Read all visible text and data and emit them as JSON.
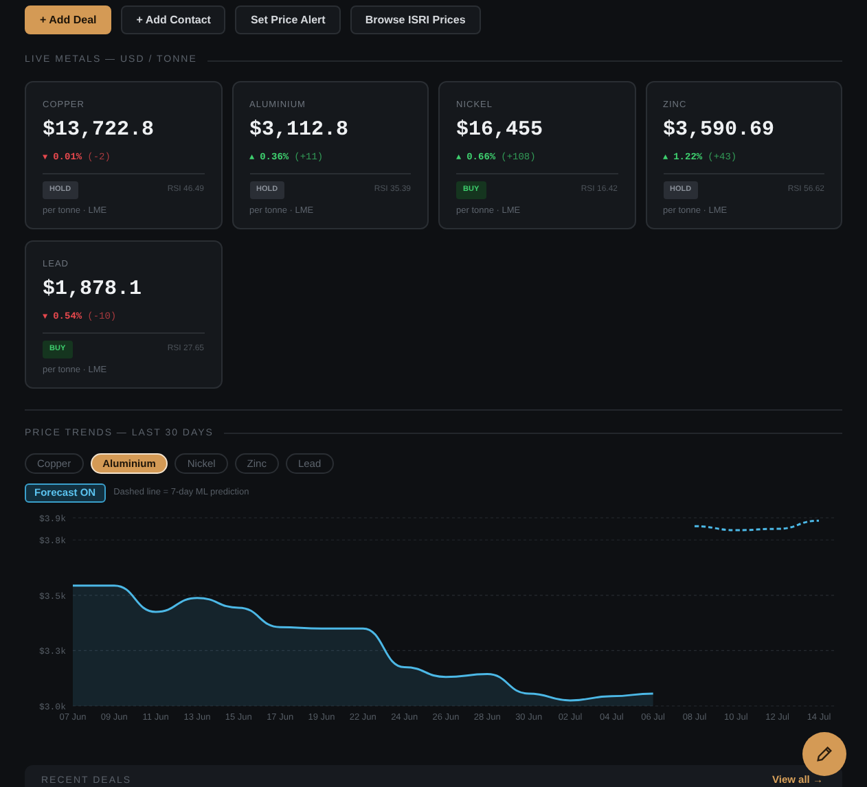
{
  "actions": [
    {
      "label": "+ Add Deal",
      "kind": "primary"
    },
    {
      "label": "+ Add Contact",
      "kind": "secondary"
    },
    {
      "label": "Set Price Alert",
      "kind": "secondary"
    },
    {
      "label": "Browse ISRI Prices",
      "kind": "secondary"
    }
  ],
  "live_metals": {
    "heading": "LIVE METALS — USD / TONNE",
    "cards": [
      {
        "name": "COPPER",
        "price": "$13,722.8",
        "rising": false,
        "arrow": "▼",
        "percent": "0.01%",
        "delta": "(-2)",
        "signal": "HOLD",
        "buy_signal": false,
        "rsi": "RSI 46.49",
        "unit": "per tonne · LME"
      },
      {
        "name": "ALUMINIUM",
        "price": "$3,112.8",
        "rising": true,
        "arrow": "▲",
        "percent": "0.36%",
        "delta": "(+11)",
        "signal": "HOLD",
        "buy_signal": false,
        "rsi": "RSI 35.39",
        "unit": "per tonne · LME"
      },
      {
        "name": "NICKEL",
        "price": "$16,455",
        "rising": true,
        "arrow": "▲",
        "percent": "0.66%",
        "delta": "(+108)",
        "signal": "BUY",
        "buy_signal": true,
        "rsi": "RSI 16.42",
        "unit": "per tonne · LME"
      },
      {
        "name": "ZINC",
        "price": "$3,590.69",
        "rising": true,
        "arrow": "▲",
        "percent": "1.22%",
        "delta": "(+43)",
        "signal": "HOLD",
        "buy_signal": false,
        "rsi": "RSI 56.62",
        "unit": "per tonne · LME"
      },
      {
        "name": "LEAD",
        "price": "$1,878.1",
        "rising": false,
        "arrow": "▼",
        "percent": "0.54%",
        "delta": "(-10)",
        "signal": "BUY",
        "buy_signal": true,
        "rsi": "RSI 27.65",
        "unit": "per tonne · LME"
      }
    ]
  },
  "price_trends": {
    "heading": "PRICE TRENDS — LAST 30 DAYS",
    "tabs": [
      {
        "label": "Copper",
        "selected": false
      },
      {
        "label": "Aluminium",
        "selected": true
      },
      {
        "label": "Nickel",
        "selected": false
      },
      {
        "label": "Zinc",
        "selected": false
      },
      {
        "label": "Lead",
        "selected": false
      }
    ],
    "forecast_toggle": {
      "label": "Forecast ON",
      "on": true
    },
    "forecast_note": "Dashed line = 7-day ML prediction",
    "chart_data": {
      "type": "area",
      "categories": [
        "07 Jun",
        "09 Jun",
        "11 Jun",
        "13 Jun",
        "15 Jun",
        "17 Jun",
        "19 Jun",
        "22 Jun",
        "24 Jun",
        "26 Jun",
        "28 Jun",
        "30 Jun",
        "02 Jul",
        "04 Jul",
        "06 Jul",
        "08 Jul",
        "10 Jul",
        "12 Jul",
        "14 Jul"
      ],
      "ylim": [
        3000,
        3850
      ],
      "yticks": [
        {
          "value": 3000,
          "label": "$3.0k"
        },
        {
          "value": 3250,
          "label": "$3.3k"
        },
        {
          "value": 3500,
          "label": "$3.5k"
        },
        {
          "value": 3750,
          "label": "$3.8k"
        },
        {
          "value": 3850,
          "label": "$3.9k"
        }
      ],
      "grid": true,
      "series": [
        {
          "line_style": "solid",
          "color": "#4cb8e6",
          "values": [
            3544,
            3544,
            3425,
            3488,
            3444,
            3356,
            3350,
            3350,
            3175,
            3131,
            3144,
            3056,
            3025,
            3044,
            3056,
            null,
            null,
            null,
            null
          ]
        },
        {
          "type": "line",
          "line_style": "dashed",
          "color": "#4cb8e6",
          "values": [
            null,
            null,
            null,
            null,
            null,
            null,
            null,
            null,
            null,
            null,
            null,
            null,
            null,
            null,
            null,
            3812,
            3794,
            3800,
            3837
          ]
        }
      ]
    }
  },
  "recent_deals": {
    "heading": "RECENT DEALS",
    "link": "View all →"
  }
}
